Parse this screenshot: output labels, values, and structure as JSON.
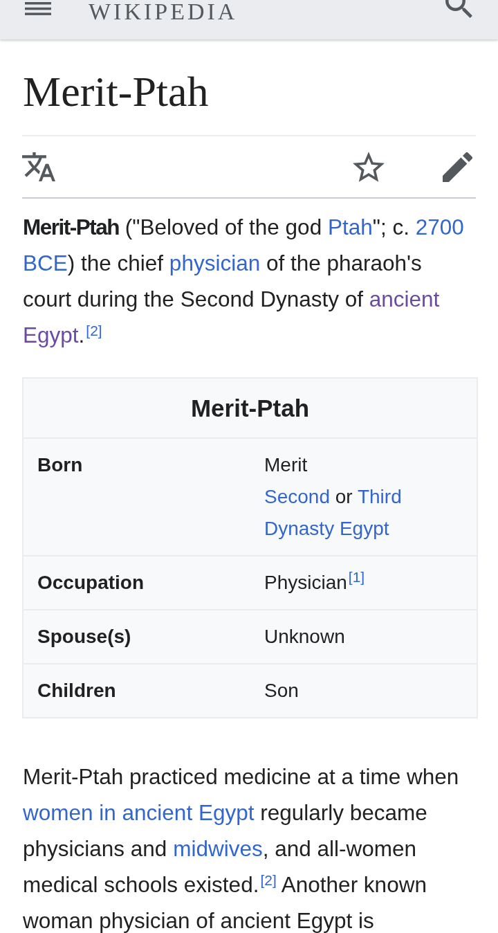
{
  "header": {
    "wordmark": "WIKIPEDIA"
  },
  "article": {
    "title": "Merit-Ptah",
    "watched": false,
    "lead": [
      {
        "kind": "bold",
        "text": "Merit-Ptah"
      },
      {
        "kind": "text",
        "text": " (\"Beloved of the god "
      },
      {
        "kind": "link",
        "text": "Ptah",
        "visited": false
      },
      {
        "kind": "text",
        "text": "\"; c. "
      },
      {
        "kind": "link",
        "parts": [
          "2700",
          "BCE"
        ],
        "visited": false
      },
      {
        "kind": "text",
        "text": ") the chief "
      },
      {
        "kind": "link",
        "text": "physician",
        "visited": false
      },
      {
        "kind": "text",
        "text": " of the pharaoh's court during the Second Dynasty of "
      },
      {
        "kind": "link",
        "parts": [
          "ancient",
          "Egypt"
        ],
        "visited": true
      },
      {
        "kind": "text",
        "text": "."
      },
      {
        "kind": "ref",
        "text": "[2]"
      }
    ],
    "infobox": {
      "caption": "Merit-Ptah",
      "rows": [
        {
          "label": "Born",
          "lines": [
            [
              {
                "kind": "text",
                "text": "Merit"
              }
            ],
            [
              {
                "kind": "link",
                "text": "Second",
                "visited": false
              },
              {
                "kind": "text",
                "text": " or "
              },
              {
                "kind": "link",
                "parts": [
                  "Third",
                  "Dynasty Egypt"
                ],
                "visited": false
              }
            ]
          ]
        },
        {
          "label": "Occupation",
          "lines": [
            [
              {
                "kind": "text",
                "text": "Physician"
              },
              {
                "kind": "ref",
                "text": "[1]"
              }
            ]
          ]
        },
        {
          "label": "Spouse(s)",
          "lines": [
            [
              {
                "kind": "text",
                "text": "Unknown"
              }
            ]
          ]
        },
        {
          "label": "Children",
          "lines": [
            [
              {
                "kind": "text",
                "text": "Son"
              }
            ]
          ]
        }
      ]
    },
    "body": [
      {
        "kind": "text",
        "text": "Merit-Ptah practiced medicine at a time when "
      },
      {
        "kind": "link",
        "text": "women in ancient Egypt",
        "visited": false
      },
      {
        "kind": "text",
        "text": " regularly became physicians and "
      },
      {
        "kind": "link",
        "text": "midwives",
        "visited": false
      },
      {
        "kind": "text",
        "text": ", and all-women medical schools existed."
      },
      {
        "kind": "ref",
        "text": "[2]"
      },
      {
        "kind": "text",
        "text": " Another known woman physician of ancient Egypt is"
      }
    ]
  }
}
